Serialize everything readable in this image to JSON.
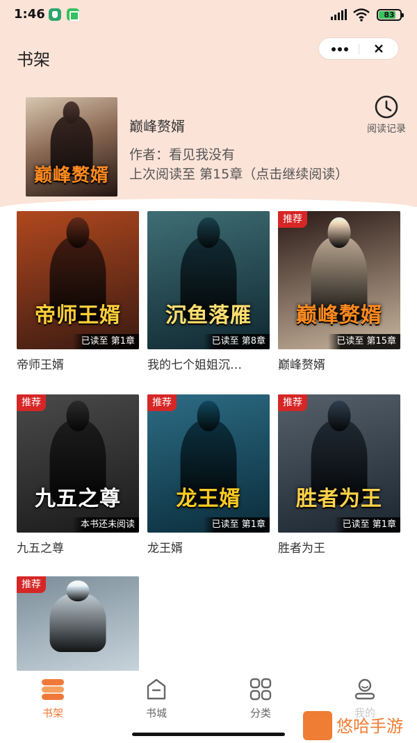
{
  "status_bar": {
    "time": "1:46",
    "battery": "83",
    "apps": [
      "shield-app-icon",
      "wechat-app-icon"
    ]
  },
  "header": {
    "title": "书架",
    "more_icon": "more-icon",
    "close_icon": "close-icon"
  },
  "recent": {
    "cover_title": "巅峰赘婿",
    "title": "巅峰赘婿",
    "author": "作者：看见我没有",
    "progress": "上次阅读至 第15章（点击继续阅读）",
    "history_label": "阅读记录",
    "history_icon": "clock-icon"
  },
  "books": [
    {
      "name": "帝师王婿",
      "cover_title": "帝师王婿",
      "badge": "",
      "status": "已读至 第1章",
      "colors": [
        "#3a1a12",
        "#b0481e"
      ],
      "title_color": "#ffcf3a"
    },
    {
      "name": "我的七个姐姐沉…",
      "cover_title": "沉鱼落雁",
      "badge": "",
      "status": "已读至 第8章",
      "colors": [
        "#0f2730",
        "#3f6e74"
      ],
      "title_color": "#ffe070"
    },
    {
      "name": "巅峰赘婿",
      "cover_title": "巅峰赘婿",
      "badge": "推荐",
      "status": "已读至 第15章",
      "colors": [
        "#c9b59e",
        "#2a1a16"
      ],
      "title_color": "#ff8a1f"
    },
    {
      "name": "九五之尊",
      "cover_title": "九五之尊",
      "badge": "推荐",
      "status": "本书还未阅读",
      "colors": [
        "#1a1a1a",
        "#4a4a4a"
      ],
      "title_color": "#ffffff"
    },
    {
      "name": "龙王婿",
      "cover_title": "龙王婿",
      "badge": "推荐",
      "status": "已读至 第1章",
      "colors": [
        "#0a2c3a",
        "#2d6c85"
      ],
      "title_color": "#ffcc22"
    },
    {
      "name": "胜者为王",
      "cover_title": "胜者为王",
      "badge": "推荐",
      "status": "已读至 第1章",
      "colors": [
        "#1c2630",
        "#55606b"
      ],
      "title_color": "#ffd24a"
    },
    {
      "name": "",
      "cover_title": "",
      "badge": "推荐",
      "status": "",
      "colors": [
        "#c7d3db",
        "#7b8d99"
      ],
      "title_color": "#ffffff"
    }
  ],
  "tabbar": {
    "items": [
      {
        "label": "书架",
        "icon": "bookshelf-icon",
        "active": true
      },
      {
        "label": "书城",
        "icon": "bookstore-icon",
        "active": false
      },
      {
        "label": "分类",
        "icon": "category-icon",
        "active": false
      },
      {
        "label": "我的",
        "icon": "profile-icon",
        "active": false
      }
    ]
  },
  "watermark": {
    "text": "悠哈手游"
  },
  "colors": {
    "accent": "#f0793a",
    "header_bg": "#fbe3d8",
    "badge": "#d62626"
  }
}
